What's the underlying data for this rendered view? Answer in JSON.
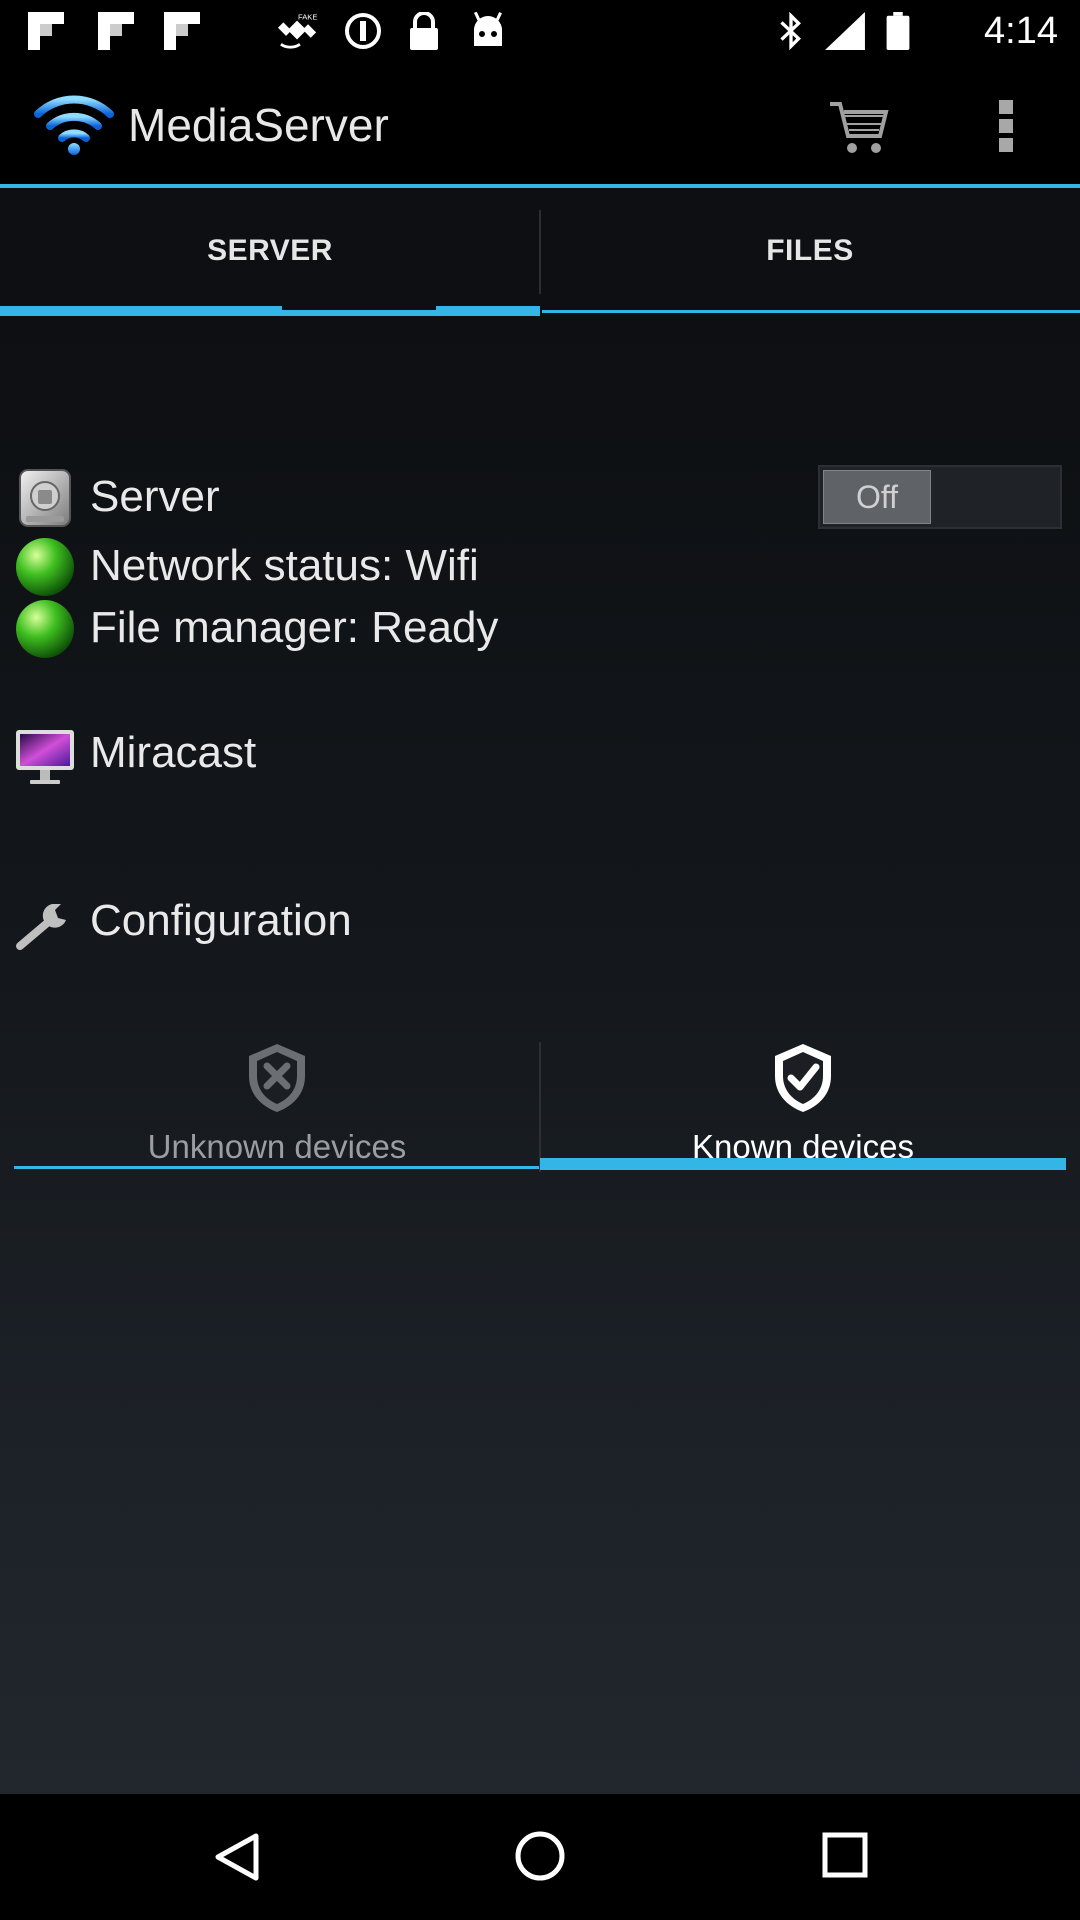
{
  "status_bar": {
    "time": "4:14",
    "left_icons": [
      "flipboard-icon",
      "flipboard-icon",
      "flipboard-icon",
      "fake-gps-icon",
      "sync-icon",
      "lock-icon",
      "android-icon"
    ],
    "right_icons": [
      "bluetooth-icon",
      "signal-icon",
      "battery-icon"
    ]
  },
  "action_bar": {
    "title": "MediaServer",
    "icons": [
      "wifi-icon",
      "cart-icon",
      "overflow-menu-icon"
    ]
  },
  "tabs": [
    {
      "label": "SERVER",
      "selected": true
    },
    {
      "label": "FILES",
      "selected": false
    }
  ],
  "rows": {
    "server": {
      "label": "Server",
      "icon": "server-drive-icon",
      "toggle": "Off"
    },
    "network": {
      "label": "Network status: Wifi",
      "icon": "green-status-icon"
    },
    "file_manager": {
      "label": "File manager: Ready",
      "icon": "green-status-icon"
    },
    "miracast": {
      "label": "Miracast",
      "icon": "monitor-icon"
    },
    "configuration": {
      "label": "Configuration",
      "icon": "wrench-icon"
    }
  },
  "device_tabs": [
    {
      "label": "Unknown devices",
      "icon": "shield-x-icon",
      "selected": false
    },
    {
      "label": "Known devices",
      "icon": "shield-check-icon",
      "selected": true
    }
  ],
  "colors": {
    "accent": "#33b5e5",
    "status_green": "#3fbf20"
  },
  "nav_bar": {
    "buttons": [
      "back-icon",
      "home-icon",
      "recents-icon"
    ]
  }
}
